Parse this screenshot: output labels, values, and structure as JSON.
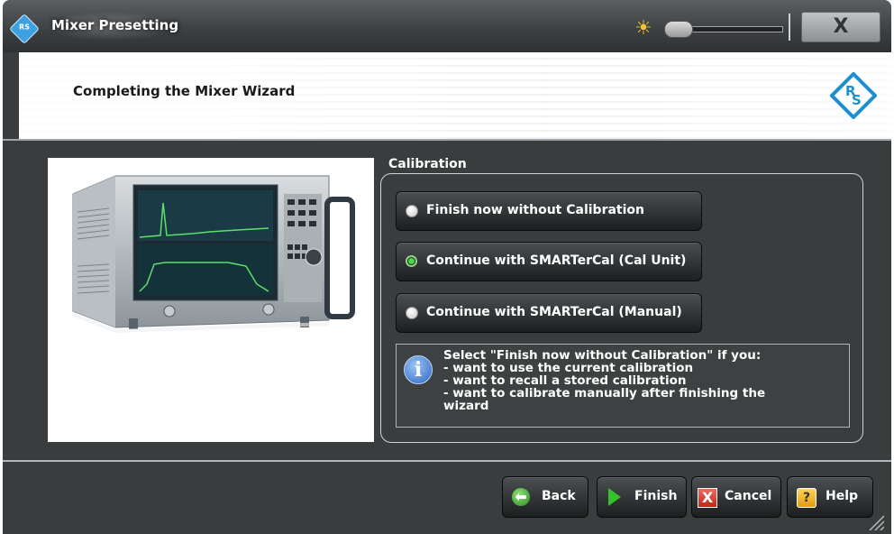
{
  "window": {
    "title": "Mixer Presetting",
    "close_symbol": "X",
    "app_icon": "rs-app-icon",
    "brightness_icon": "sun-icon"
  },
  "banner": {
    "title": "Completing the Mixer Wizard",
    "logo_text": "R&S"
  },
  "calibration": {
    "label": "Calibration",
    "options": [
      {
        "label": "Finish now without Calibration",
        "selected": false
      },
      {
        "label": "Continue with SMARTerCal (Cal Unit)",
        "selected": true
      },
      {
        "label": "Continue with SMARTerCal (Manual)",
        "selected": false
      }
    ],
    "info": {
      "icon": "info-icon",
      "lines": [
        "Select \"Finish now without Calibration\" if you:",
        "- want to use the current calibration",
        "- want to recall a stored calibration",
        "- want to calibrate manually after finishing the",
        "wizard"
      ]
    }
  },
  "footer": {
    "back_label": "Back",
    "finish_label": "Finish",
    "cancel_label": "Cancel",
    "help_label": "Help"
  },
  "colors": {
    "background": "#3a3d3e",
    "accent_green": "#3ee040",
    "rs_blue": "#3ea0e0"
  }
}
